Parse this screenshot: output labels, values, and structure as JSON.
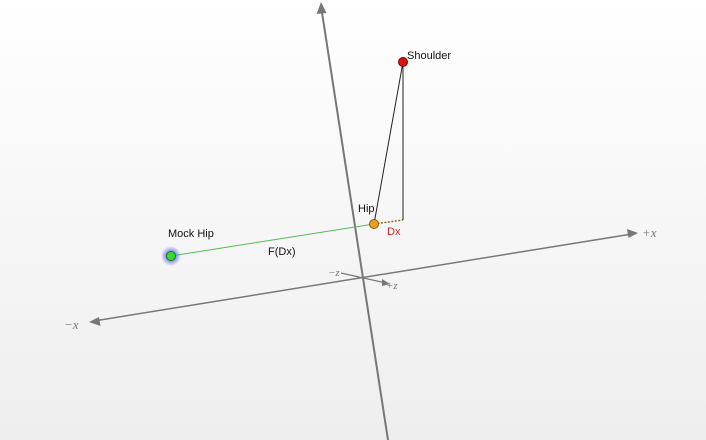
{
  "scene": {
    "background_top": "#ffffff",
    "background_bottom": "#eeeeee",
    "axis_color": "#777777",
    "axes": {
      "plus_x": "+x",
      "minus_x": "−x",
      "plus_z": "+z",
      "minus_z": "−z"
    },
    "points": {
      "shoulder": {
        "label": "Shoulder",
        "color": "#dd1111",
        "stroke": "#7a0000"
      },
      "hip": {
        "label": "Hip",
        "color": "#e8a020",
        "stroke": "#8a5a00"
      },
      "mock_hip": {
        "label": "Mock Hip",
        "color": "#33dd33",
        "stroke": "#1a7a1a",
        "halo": "#6f6ff0"
      }
    },
    "segments": {
      "dx": {
        "label": "Dx",
        "color": "#cc2222",
        "dash_color": "#8a6a2a"
      },
      "f_dx": {
        "label": "F(Dx)",
        "color": "#55bb55"
      },
      "body_line_color": "#222222"
    }
  }
}
